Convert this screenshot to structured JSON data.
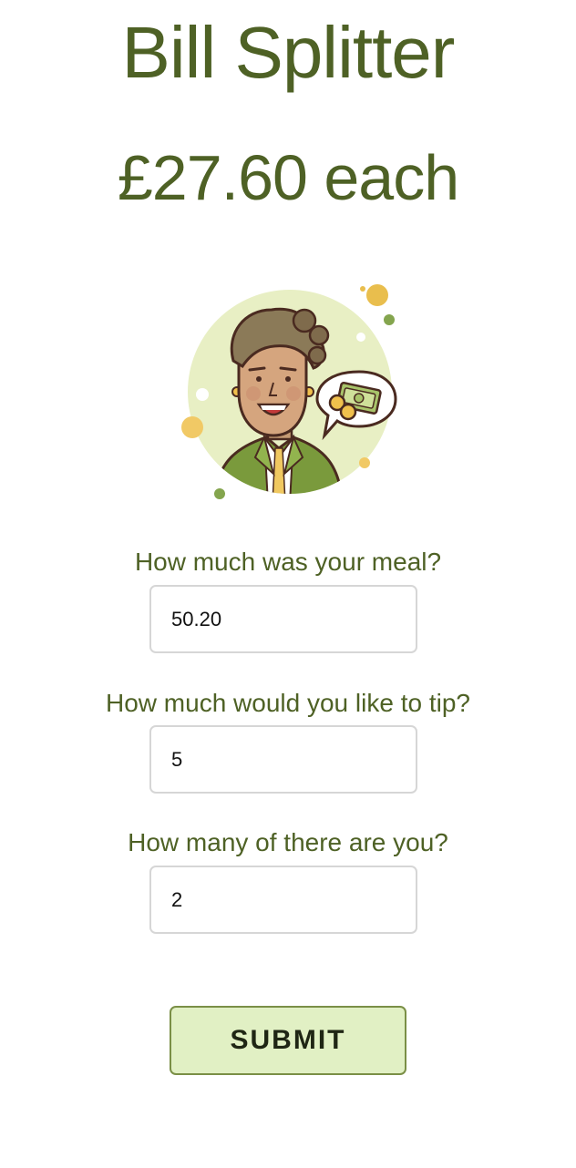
{
  "header": {
    "title": "Bill Splitter",
    "result": "£27.60 each"
  },
  "illustration": {
    "name": "person-with-money-illustration"
  },
  "form": {
    "meal": {
      "label": "How much was your meal?",
      "value": "50.20"
    },
    "tip": {
      "label": "How much would you like to tip?",
      "value": "5"
    },
    "people": {
      "label": "How many of there are you?",
      "value": "2"
    },
    "submit_label": "SUBMIT"
  },
  "colors": {
    "text_green": "#4e6125",
    "button_bg": "#e1f0c4",
    "button_border": "#7a8f46",
    "input_border": "#d6d6d6"
  }
}
